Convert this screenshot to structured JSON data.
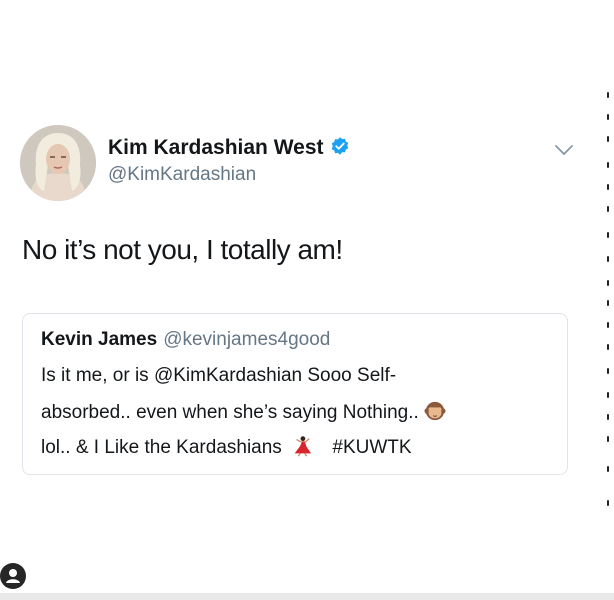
{
  "tweet": {
    "display_name": "Kim Kardashian West",
    "handle": "@KimKardashian",
    "text": "No it’s not you, I totally am!"
  },
  "quoted": {
    "display_name": "Kevin James",
    "handle": "@kevinjames4good",
    "lines": [
      "Is it me, or is @KimKardashian Sooo Self-",
      "absorbed..  even when she’s saying Nothing..",
      "lol..  & I Like the Kardashians",
      "#KUWTK"
    ]
  },
  "icons": {
    "verified": "verified-badge-icon",
    "menu": "chevron-down-icon",
    "monkey_emoji": "see-no-evil-monkey-emoji",
    "dancer_emoji": "dancer-emoji",
    "user_tag": "user-tag-icon"
  },
  "colors": {
    "verified_blue": "#1da1f2",
    "handle_gray": "#657786",
    "text": "#14171a"
  }
}
